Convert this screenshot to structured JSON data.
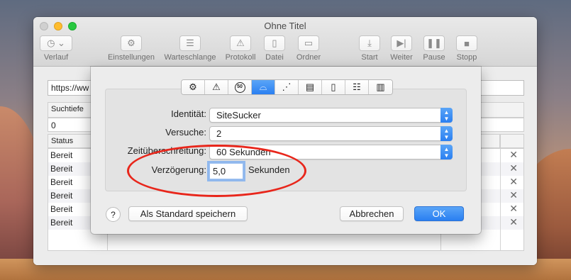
{
  "window": {
    "title": "Ohne Titel",
    "toolbar": {
      "verlauf": "Verlauf",
      "einstellungen": "Einstellungen",
      "warteschlange": "Warteschlange",
      "protokoll": "Protokoll",
      "datei": "Datei",
      "ordner": "Ordner",
      "start": "Start",
      "weiter": "Weiter",
      "pause": "Pause",
      "stopp": "Stopp"
    },
    "url_value": "https://ww",
    "suchtiefe_header": "Suchtiefe",
    "suchtiefe_value": "0",
    "status_header": "Status",
    "rows": [
      "Bereit",
      "Bereit",
      "Bereit",
      "Bereit",
      "Bereit",
      "Bereit"
    ]
  },
  "sheet": {
    "tabs": [
      "settings-tab",
      "warning-tab",
      "limits-tab",
      "identity-tab",
      "network-tab",
      "list-tab",
      "file-tab",
      "adjust-tab",
      "script-tab"
    ],
    "active_tab": "identity-tab",
    "identitaet_label": "Identität:",
    "identitaet_value": "SiteSucker",
    "versuche_label": "Versuche:",
    "versuche_value": "2",
    "zeitueberschreitung_label": "Zeitüberschreitung:",
    "zeitueberschreitung_value": "60 Sekunden",
    "verzoegerung_label": "Verzögerung:",
    "verzoegerung_value": "5,0",
    "sekunden_label": "Sekunden",
    "help_label": "?",
    "save_default_label": "Als Standard speichern",
    "cancel_label": "Abbrechen",
    "ok_label": "OK",
    "limits_glyph": "50"
  },
  "colors": {
    "accent": "#2a7ff1",
    "highlight_ellipse": "#e8261b"
  }
}
